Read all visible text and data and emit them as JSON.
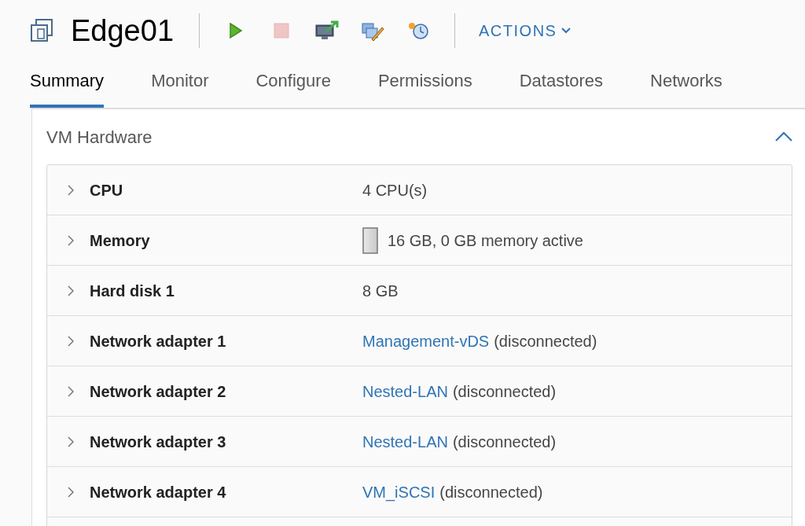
{
  "header": {
    "title": "Edge01",
    "actions_label": "ACTIONS"
  },
  "toolbar": [
    {
      "kind": "power-on",
      "disabled": false
    },
    {
      "kind": "power-off",
      "disabled": true
    },
    {
      "kind": "console",
      "disabled": false
    },
    {
      "kind": "edit",
      "disabled": false
    },
    {
      "kind": "snapshot",
      "disabled": false
    }
  ],
  "tabs": [
    {
      "label": "Summary",
      "selected": true
    },
    {
      "label": "Monitor",
      "selected": false
    },
    {
      "label": "Configure",
      "selected": false
    },
    {
      "label": "Permissions",
      "selected": false
    },
    {
      "label": "Datastores",
      "selected": false
    },
    {
      "label": "Networks",
      "selected": false
    }
  ],
  "panel": {
    "title": "VM Hardware",
    "expanded": true,
    "rows": [
      {
        "label": "CPU",
        "value_text": "4 CPU(s)"
      },
      {
        "label": "Memory",
        "meter": true,
        "value_text": "16 GB, 0 GB memory active"
      },
      {
        "label": "Hard disk 1",
        "value_text": "8 GB"
      },
      {
        "label": "Network adapter 1",
        "value_link": "Management-vDS",
        "value_text": "(disconnected)"
      },
      {
        "label": "Network adapter 2",
        "value_link": "Nested-LAN",
        "value_text": "(disconnected)"
      },
      {
        "label": "Network adapter 3",
        "value_link": "Nested-LAN",
        "value_text": "(disconnected)"
      },
      {
        "label": "Network adapter 4",
        "value_link": "VM_iSCSI",
        "value_text": "(disconnected)"
      }
    ]
  }
}
